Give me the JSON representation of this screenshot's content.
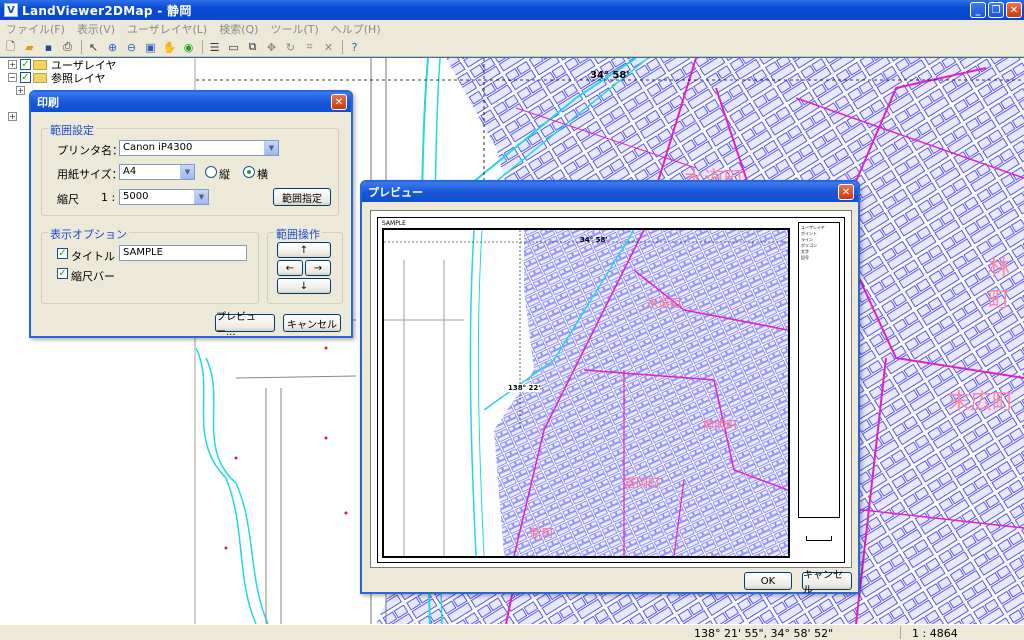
{
  "window": {
    "title": "LandViewer2DMap - 静岡",
    "app_icon": "V"
  },
  "menu": [
    "ファイル(F)",
    "表示(V)",
    "ユーザレイヤ(L)",
    "検索(Q)",
    "ツール(T)",
    "ヘルプ(H)"
  ],
  "tree": {
    "items": [
      "ユーザレイヤ",
      "参照レイヤ"
    ]
  },
  "print_dialog": {
    "title": "印刷",
    "range_group": "範囲設定",
    "printer_label": "プリンタ名：",
    "printer_value": "Canon iP4300",
    "paper_label": "用紙サイズ：",
    "paper_value": "A4",
    "portrait_label": "縦",
    "landscape_label": "横",
    "scale_label": "縮尺",
    "scale_prefix": "1 :",
    "scale_value": "5000",
    "range_button": "範囲指定",
    "display_group": "表示オプション",
    "title_checkbox": "タイトル",
    "title_value": "SAMPLE",
    "scalebar_checkbox": "縮尺バー",
    "ops_group": "範囲操作",
    "up": "↑",
    "left": "←",
    "right": "→",
    "down": "↓",
    "preview_button": "プレビュー...",
    "cancel_button": "キャンセル"
  },
  "preview_dialog": {
    "title": "プレビュー",
    "sheet_title": "SAMPLE",
    "ok_button": "OK",
    "cancel_button": "キャンセル",
    "legend_items": [
      "ユーザレイヤ",
      "ポイント",
      "ライン",
      "ポリゴン",
      "文字",
      "記号"
    ]
  },
  "map": {
    "lat_label": "34° 58'",
    "lon_label": "138° 22'",
    "towns": [
      "水道町",
      "末広町",
      "林町",
      "神明町",
      "富岡町",
      "新町"
    ]
  },
  "status": {
    "coords": "138° 21' 55\", 34° 58' 52\"",
    "scale": "1 : 4864"
  },
  "colors": {
    "titlebar": "#0a4ad6",
    "parcel": "#2020ff",
    "boundary": "#e020c8",
    "river": "#20d8e8"
  }
}
